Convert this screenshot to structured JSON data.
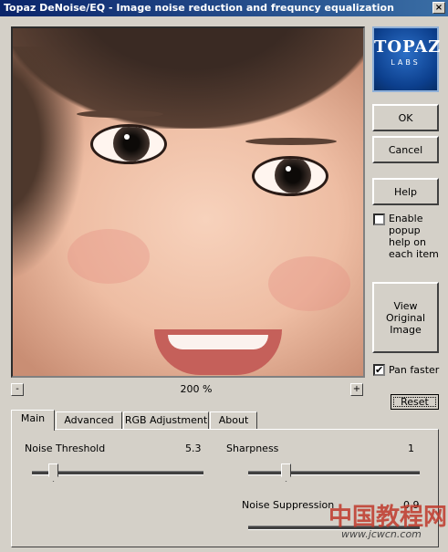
{
  "window": {
    "title": "Topaz DeNoise/EQ - Image noise reduction and frequncy equalization",
    "close_glyph": "×"
  },
  "preview": {
    "zoom": "200 %",
    "minus": "-",
    "plus": "+"
  },
  "logo": {
    "line1": "TOPAZ",
    "line2": "LABS"
  },
  "buttons": {
    "ok": "OK",
    "cancel": "Cancel",
    "help": "Help",
    "view_original": "View Original Image",
    "reset": "Reset"
  },
  "options": {
    "enable_popup_help": {
      "label": "Enable popup help on each item",
      "checked": false
    },
    "pan_faster": {
      "label": "Pan faster",
      "checked": true,
      "mark": "✔"
    }
  },
  "tabs": [
    {
      "label": "Main",
      "active": true
    },
    {
      "label": "Advanced",
      "active": false
    },
    {
      "label": "RGB Adjustment",
      "active": false
    },
    {
      "label": "About",
      "active": false
    }
  ],
  "main": {
    "noise_threshold": {
      "label": "Noise Threshold",
      "value": "5.3"
    },
    "sharpness": {
      "label": "Sharpness",
      "value": "1"
    },
    "noise_suppression": {
      "label": "Noise Suppression",
      "value": "0.9"
    }
  },
  "watermark": {
    "text": "中国教程网",
    "url": "www.jcwcn.com"
  }
}
